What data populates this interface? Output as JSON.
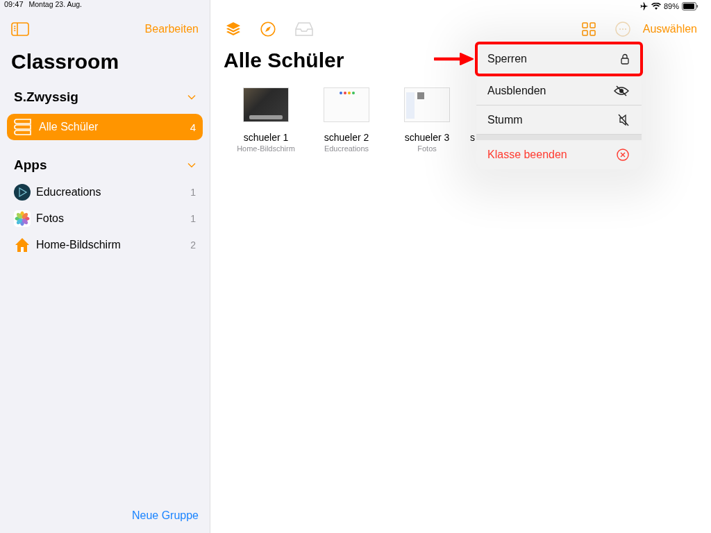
{
  "status_bar": {
    "time": "09:47",
    "date": "Montag 23. Aug.",
    "battery": "89%"
  },
  "sidebar": {
    "edit_label": "Bearbeiten",
    "title": "Classroom",
    "footer_link": "Neue Gruppe",
    "sections": [
      {
        "title": "S.Zwyssig",
        "expanded": true,
        "items": [
          {
            "kind": "students",
            "label": "Alle Schüler",
            "count": "4",
            "selected": true
          }
        ]
      },
      {
        "title": "Apps",
        "expanded": true,
        "items": [
          {
            "kind": "educreations",
            "label": "Educreations",
            "count": "1",
            "selected": false
          },
          {
            "kind": "photos",
            "label": "Fotos",
            "count": "1",
            "selected": false
          },
          {
            "kind": "home",
            "label": "Home-Bildschirm",
            "count": "2",
            "selected": false
          }
        ]
      }
    ]
  },
  "toolbar": {
    "tools": [
      {
        "kind": "layers",
        "disabled": false
      },
      {
        "kind": "compass",
        "disabled": false
      },
      {
        "kind": "tray",
        "disabled": true
      }
    ],
    "select_label": "Auswählen"
  },
  "main": {
    "title": "Alle Schüler",
    "students": [
      {
        "kind": "home",
        "name": "schueler 1",
        "app": "Home-Bildschirm"
      },
      {
        "kind": "blank",
        "name": "schueler 2",
        "app": "Educreations"
      },
      {
        "kind": "list",
        "name": "schueler 3",
        "app": "Fotos"
      },
      {
        "kind": "hidden",
        "name": "s"
      }
    ]
  },
  "menu": {
    "items": [
      {
        "kind": "lock",
        "label": "Sperren",
        "highlighted": true
      },
      {
        "kind": "hide",
        "label": "Ausblenden",
        "highlighted": false
      },
      {
        "kind": "mute",
        "label": "Stumm",
        "highlighted": false
      },
      {
        "kind": "end",
        "label": "Klasse beenden",
        "highlighted": false
      }
    ]
  }
}
